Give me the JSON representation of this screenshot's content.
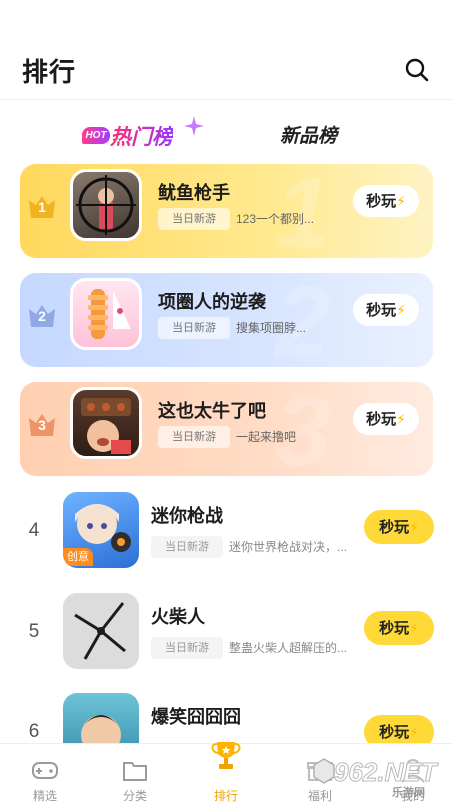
{
  "header": {
    "title": "排行"
  },
  "tabs": {
    "hot_badge": "HOT",
    "hot_label": "热门榜",
    "new_label": "新品榜"
  },
  "colors": {
    "accent_yellow": "#ffd938",
    "gold": "#ffb800",
    "active_nav": "#f0a300"
  },
  "top_cards": [
    {
      "rank": "1",
      "big_number": "1",
      "name": "鱿鱼枪手",
      "tag": "当日新游",
      "desc": "123一个都别...",
      "play": "秒玩",
      "play_icon": "⚡"
    },
    {
      "rank": "2",
      "big_number": "2",
      "name": "项圈人的逆袭",
      "tag": "当日新游",
      "desc": "搜集项圈脖...",
      "play": "秒玩",
      "play_icon": "⚡"
    },
    {
      "rank": "3",
      "big_number": "3",
      "name": "这也太牛了吧",
      "tag": "当日新游",
      "desc": "一起来撸吧",
      "play": "秒玩",
      "play_icon": "⚡"
    }
  ],
  "list": [
    {
      "rank": "4",
      "name": "迷你枪战",
      "tag": "当日新游",
      "desc": "迷你世界枪战对决，...",
      "play": "秒玩",
      "play_icon": "⚡",
      "badge": "创意"
    },
    {
      "rank": "5",
      "name": "火柴人",
      "tag": "当日新游",
      "desc": "整蛊火柴人超解压的...",
      "play": "秒玩",
      "play_icon": "⚡"
    },
    {
      "rank": "6",
      "name": "爆笑囧囧囧",
      "play": "秒玩",
      "play_icon": "⚡"
    }
  ],
  "nav": [
    {
      "label": "精选",
      "icon": "gamepad-icon"
    },
    {
      "label": "分类",
      "icon": "folder-icon"
    },
    {
      "label": "排行",
      "icon": "trophy-icon",
      "active": true
    },
    {
      "label": "福利",
      "icon": "gift-icon"
    },
    {
      "label": "我的",
      "icon": "profile-icon"
    }
  ],
  "watermark": {
    "text": "962.NET",
    "sub": "乐游网"
  }
}
